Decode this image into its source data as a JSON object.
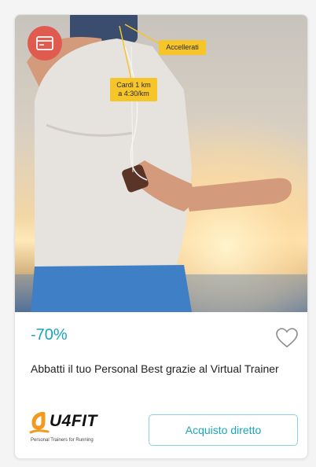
{
  "card": {
    "tags": {
      "tag_1": "Accellerati",
      "tag_2": "Cardi 1 km a 4:30/km"
    },
    "discount": "-70%",
    "title": "Abbatti il tuo Personal Best grazie al Virtual Trainer",
    "brand": {
      "name": "U4FIT",
      "tagline": "Personal Trainers for Running"
    },
    "buy_label": "Acquisto diretto"
  },
  "icons": {
    "badge": "card-offer-icon",
    "favorite": "heart-icon"
  },
  "colors": {
    "accent": "#1aa5bf",
    "badge": "#df5a4f",
    "tag": "#f6c52a",
    "button_border": "#8ad3e0",
    "logo_orange": "#f29a1f"
  }
}
